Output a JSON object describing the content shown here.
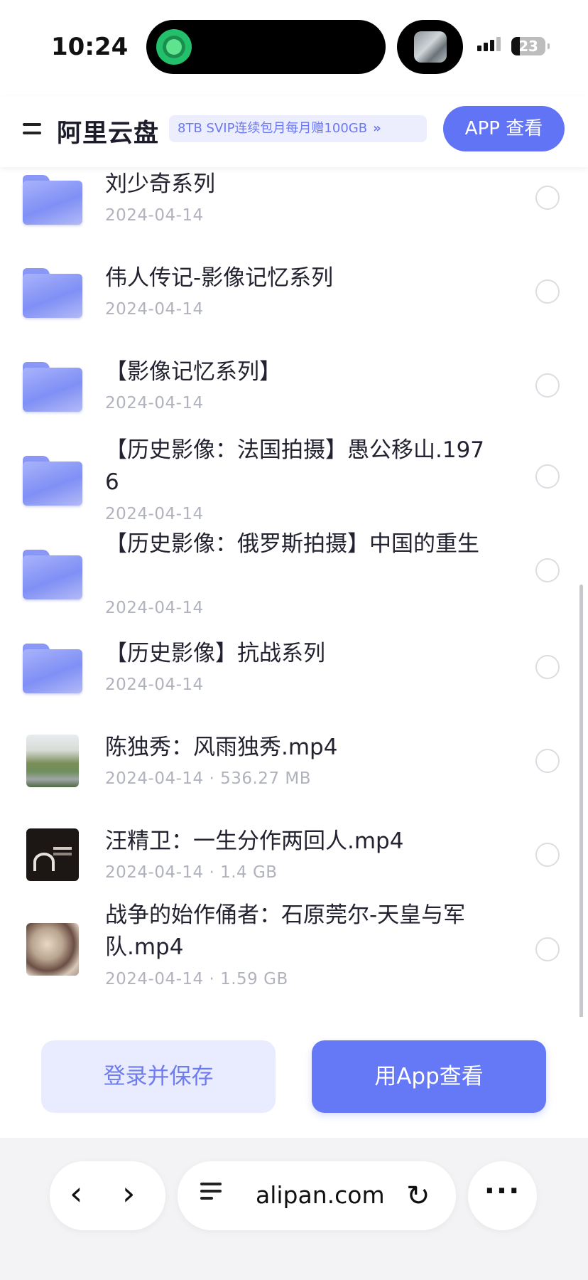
{
  "status_bar": {
    "time": "10:24",
    "battery": "23"
  },
  "header": {
    "brand": "阿里云盘",
    "promo": "8TB SVIP连续包月每月赠100GB",
    "promo_chevron": "»",
    "app_button": "APP 查看"
  },
  "files": [
    {
      "type": "folder",
      "title": "刘少奇系列",
      "meta": "2024-04-14"
    },
    {
      "type": "folder",
      "title": "伟人传记-影像记忆系列",
      "meta": "2024-04-14"
    },
    {
      "type": "folder",
      "title": "【影像记忆系列】",
      "meta": "2024-04-14"
    },
    {
      "type": "folder",
      "title": "【历史影像：法国拍摄】愚公移山.1976",
      "meta": "2024-04-14"
    },
    {
      "type": "folder",
      "title": "【历史影像：俄罗斯拍摄】中国的重生",
      "meta": "2024-04-14"
    },
    {
      "type": "folder",
      "title": "【历史影像】抗战系列",
      "meta": "2024-04-14"
    },
    {
      "type": "video",
      "title": "陈独秀：风雨独秀.mp4",
      "meta": "2024-04-14 · 536.27 MB"
    },
    {
      "type": "video",
      "title": "汪精卫：一生分作两回人.mp4",
      "meta": "2024-04-14 · 1.4 GB"
    },
    {
      "type": "video",
      "title": "战争的始作俑者：石原莞尔-天皇与军队.mp4",
      "meta": "2024-04-14 · 1.59 GB"
    }
  ],
  "actions": {
    "login_save": "登录并保存",
    "open_app": "用App查看"
  },
  "browser": {
    "back": "‹",
    "forward": "›",
    "url": "alipan.com",
    "reload": "↻",
    "more": "···"
  },
  "colors": {
    "accent": "#6274f6",
    "accent_light": "#e9ecfe",
    "folder": "#8a97f6"
  }
}
